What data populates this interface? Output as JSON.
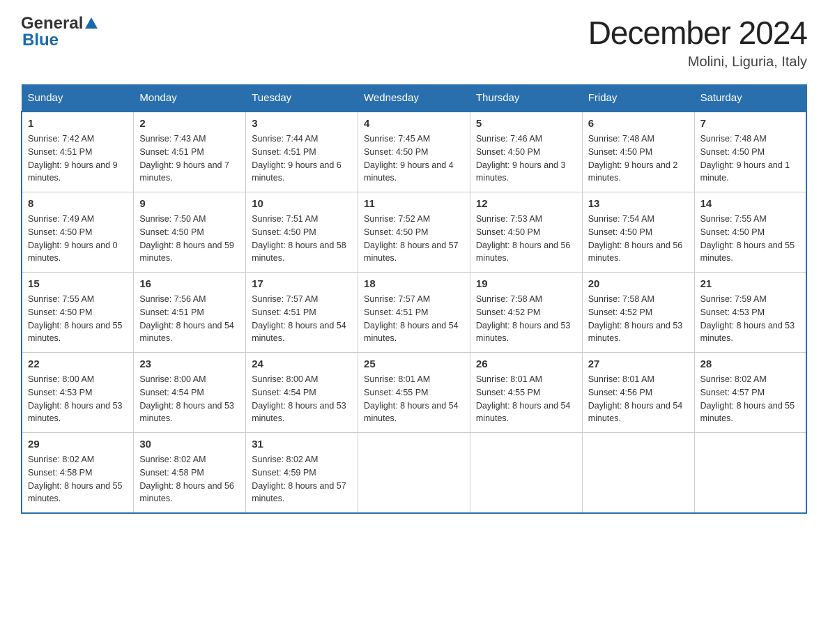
{
  "header": {
    "title": "December 2024",
    "subtitle": "Molini, Liguria, Italy",
    "logo_general": "General",
    "logo_blue": "Blue"
  },
  "days_of_week": [
    "Sunday",
    "Monday",
    "Tuesday",
    "Wednesday",
    "Thursday",
    "Friday",
    "Saturday"
  ],
  "weeks": [
    [
      {
        "day": "1",
        "sunrise": "7:42 AM",
        "sunset": "4:51 PM",
        "daylight": "9 hours and 9 minutes."
      },
      {
        "day": "2",
        "sunrise": "7:43 AM",
        "sunset": "4:51 PM",
        "daylight": "9 hours and 7 minutes."
      },
      {
        "day": "3",
        "sunrise": "7:44 AM",
        "sunset": "4:51 PM",
        "daylight": "9 hours and 6 minutes."
      },
      {
        "day": "4",
        "sunrise": "7:45 AM",
        "sunset": "4:50 PM",
        "daylight": "9 hours and 4 minutes."
      },
      {
        "day": "5",
        "sunrise": "7:46 AM",
        "sunset": "4:50 PM",
        "daylight": "9 hours and 3 minutes."
      },
      {
        "day": "6",
        "sunrise": "7:48 AM",
        "sunset": "4:50 PM",
        "daylight": "9 hours and 2 minutes."
      },
      {
        "day": "7",
        "sunrise": "7:48 AM",
        "sunset": "4:50 PM",
        "daylight": "9 hours and 1 minute."
      }
    ],
    [
      {
        "day": "8",
        "sunrise": "7:49 AM",
        "sunset": "4:50 PM",
        "daylight": "9 hours and 0 minutes."
      },
      {
        "day": "9",
        "sunrise": "7:50 AM",
        "sunset": "4:50 PM",
        "daylight": "8 hours and 59 minutes."
      },
      {
        "day": "10",
        "sunrise": "7:51 AM",
        "sunset": "4:50 PM",
        "daylight": "8 hours and 58 minutes."
      },
      {
        "day": "11",
        "sunrise": "7:52 AM",
        "sunset": "4:50 PM",
        "daylight": "8 hours and 57 minutes."
      },
      {
        "day": "12",
        "sunrise": "7:53 AM",
        "sunset": "4:50 PM",
        "daylight": "8 hours and 56 minutes."
      },
      {
        "day": "13",
        "sunrise": "7:54 AM",
        "sunset": "4:50 PM",
        "daylight": "8 hours and 56 minutes."
      },
      {
        "day": "14",
        "sunrise": "7:55 AM",
        "sunset": "4:50 PM",
        "daylight": "8 hours and 55 minutes."
      }
    ],
    [
      {
        "day": "15",
        "sunrise": "7:55 AM",
        "sunset": "4:50 PM",
        "daylight": "8 hours and 55 minutes."
      },
      {
        "day": "16",
        "sunrise": "7:56 AM",
        "sunset": "4:51 PM",
        "daylight": "8 hours and 54 minutes."
      },
      {
        "day": "17",
        "sunrise": "7:57 AM",
        "sunset": "4:51 PM",
        "daylight": "8 hours and 54 minutes."
      },
      {
        "day": "18",
        "sunrise": "7:57 AM",
        "sunset": "4:51 PM",
        "daylight": "8 hours and 54 minutes."
      },
      {
        "day": "19",
        "sunrise": "7:58 AM",
        "sunset": "4:52 PM",
        "daylight": "8 hours and 53 minutes."
      },
      {
        "day": "20",
        "sunrise": "7:58 AM",
        "sunset": "4:52 PM",
        "daylight": "8 hours and 53 minutes."
      },
      {
        "day": "21",
        "sunrise": "7:59 AM",
        "sunset": "4:53 PM",
        "daylight": "8 hours and 53 minutes."
      }
    ],
    [
      {
        "day": "22",
        "sunrise": "8:00 AM",
        "sunset": "4:53 PM",
        "daylight": "8 hours and 53 minutes."
      },
      {
        "day": "23",
        "sunrise": "8:00 AM",
        "sunset": "4:54 PM",
        "daylight": "8 hours and 53 minutes."
      },
      {
        "day": "24",
        "sunrise": "8:00 AM",
        "sunset": "4:54 PM",
        "daylight": "8 hours and 53 minutes."
      },
      {
        "day": "25",
        "sunrise": "8:01 AM",
        "sunset": "4:55 PM",
        "daylight": "8 hours and 54 minutes."
      },
      {
        "day": "26",
        "sunrise": "8:01 AM",
        "sunset": "4:55 PM",
        "daylight": "8 hours and 54 minutes."
      },
      {
        "day": "27",
        "sunrise": "8:01 AM",
        "sunset": "4:56 PM",
        "daylight": "8 hours and 54 minutes."
      },
      {
        "day": "28",
        "sunrise": "8:02 AM",
        "sunset": "4:57 PM",
        "daylight": "8 hours and 55 minutes."
      }
    ],
    [
      {
        "day": "29",
        "sunrise": "8:02 AM",
        "sunset": "4:58 PM",
        "daylight": "8 hours and 55 minutes."
      },
      {
        "day": "30",
        "sunrise": "8:02 AM",
        "sunset": "4:58 PM",
        "daylight": "8 hours and 56 minutes."
      },
      {
        "day": "31",
        "sunrise": "8:02 AM",
        "sunset": "4:59 PM",
        "daylight": "8 hours and 57 minutes."
      },
      null,
      null,
      null,
      null
    ]
  ],
  "labels": {
    "sunrise": "Sunrise:",
    "sunset": "Sunset:",
    "daylight": "Daylight:"
  }
}
